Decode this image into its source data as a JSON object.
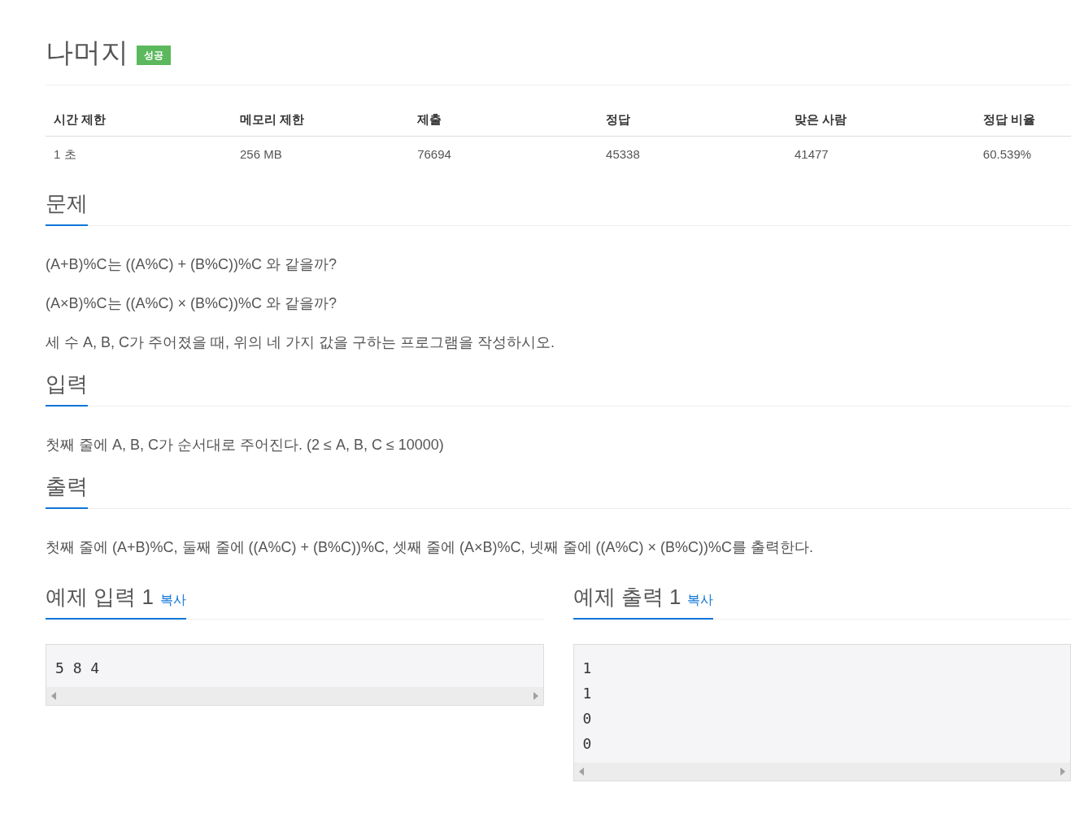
{
  "title": "나머지",
  "badge": "성공",
  "stats": {
    "columns": [
      "시간 제한",
      "메모리 제한",
      "제출",
      "정답",
      "맞은 사람",
      "정답 비율"
    ],
    "row": [
      "1 초",
      "256 MB",
      "76694",
      "45338",
      "41477",
      "60.539%"
    ]
  },
  "sections": [
    {
      "heading": "문제",
      "paragraphs": [
        "(A+B)%C는 ((A%C) + (B%C))%C 와 같을까?",
        "(A×B)%C는 ((A%C) × (B%C))%C 와 같을까?",
        "세 수 A, B, C가 주어졌을 때, 위의 네 가지 값을 구하는 프로그램을 작성하시오."
      ]
    },
    {
      "heading": "입력",
      "paragraphs": [
        "첫째 줄에 A, B, C가 순서대로 주어진다. (2 ≤ A, B, C ≤ 10000)"
      ]
    },
    {
      "heading": "출력",
      "paragraphs": [
        "첫째 줄에 (A+B)%C, 둘째 줄에 ((A%C) + (B%C))%C, 셋째 줄에 (A×B)%C, 넷째 줄에 ((A%C) × (B%C))%C를 출력한다."
      ]
    }
  ],
  "samples": [
    {
      "heading": "예제 입력 1",
      "copy": "복사",
      "lines": [
        "5 8 4"
      ]
    },
    {
      "heading": "예제 출력 1",
      "copy": "복사",
      "lines": [
        "1",
        "1",
        "0",
        "0"
      ]
    }
  ]
}
